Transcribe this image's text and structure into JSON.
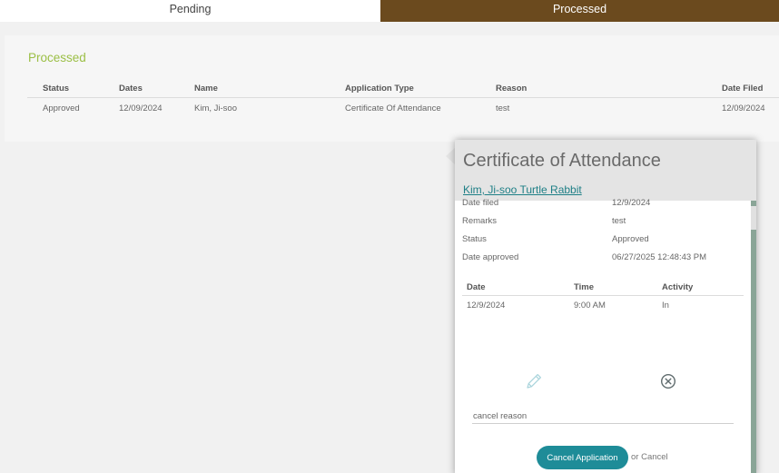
{
  "tabs": {
    "pending": "Pending",
    "processed": "Processed"
  },
  "section_title": "Processed",
  "table": {
    "headers": [
      "Status",
      "Dates",
      "Name",
      "Application Type",
      "Reason",
      "Date Filed"
    ],
    "rows": [
      [
        "Approved",
        "12/09/2024",
        "Kim, Ji-soo",
        "Certificate Of Attendance",
        "test",
        "12/09/2024"
      ]
    ]
  },
  "popover": {
    "title": "Certificate of Attendance",
    "employee_link": "Kim, Ji-soo Turtle Rabbit",
    "details": [
      {
        "label": "Date filed",
        "value": "12/9/2024"
      },
      {
        "label": "Remarks",
        "value": "test"
      },
      {
        "label": "Status",
        "value": "Approved"
      },
      {
        "label": "Date approved",
        "value": "06/27/2025 12:48:43 PM"
      }
    ],
    "activity": {
      "headers": [
        "Date",
        "Time",
        "Activity"
      ],
      "rows": [
        [
          "12/9/2024",
          "9:00 AM",
          "In"
        ]
      ]
    },
    "cancel_reason_placeholder": "cancel reason",
    "cancel_button_label": "Cancel Application",
    "or_cancel_text": "or Cancel",
    "icons": {
      "edit": "pencil-icon",
      "remove": "close-circle-icon"
    }
  },
  "colors": {
    "active_tab": "#6b4a1e",
    "section_title": "#9bbf45",
    "link": "#1e7f86",
    "primary_button": "#1e8c98"
  }
}
